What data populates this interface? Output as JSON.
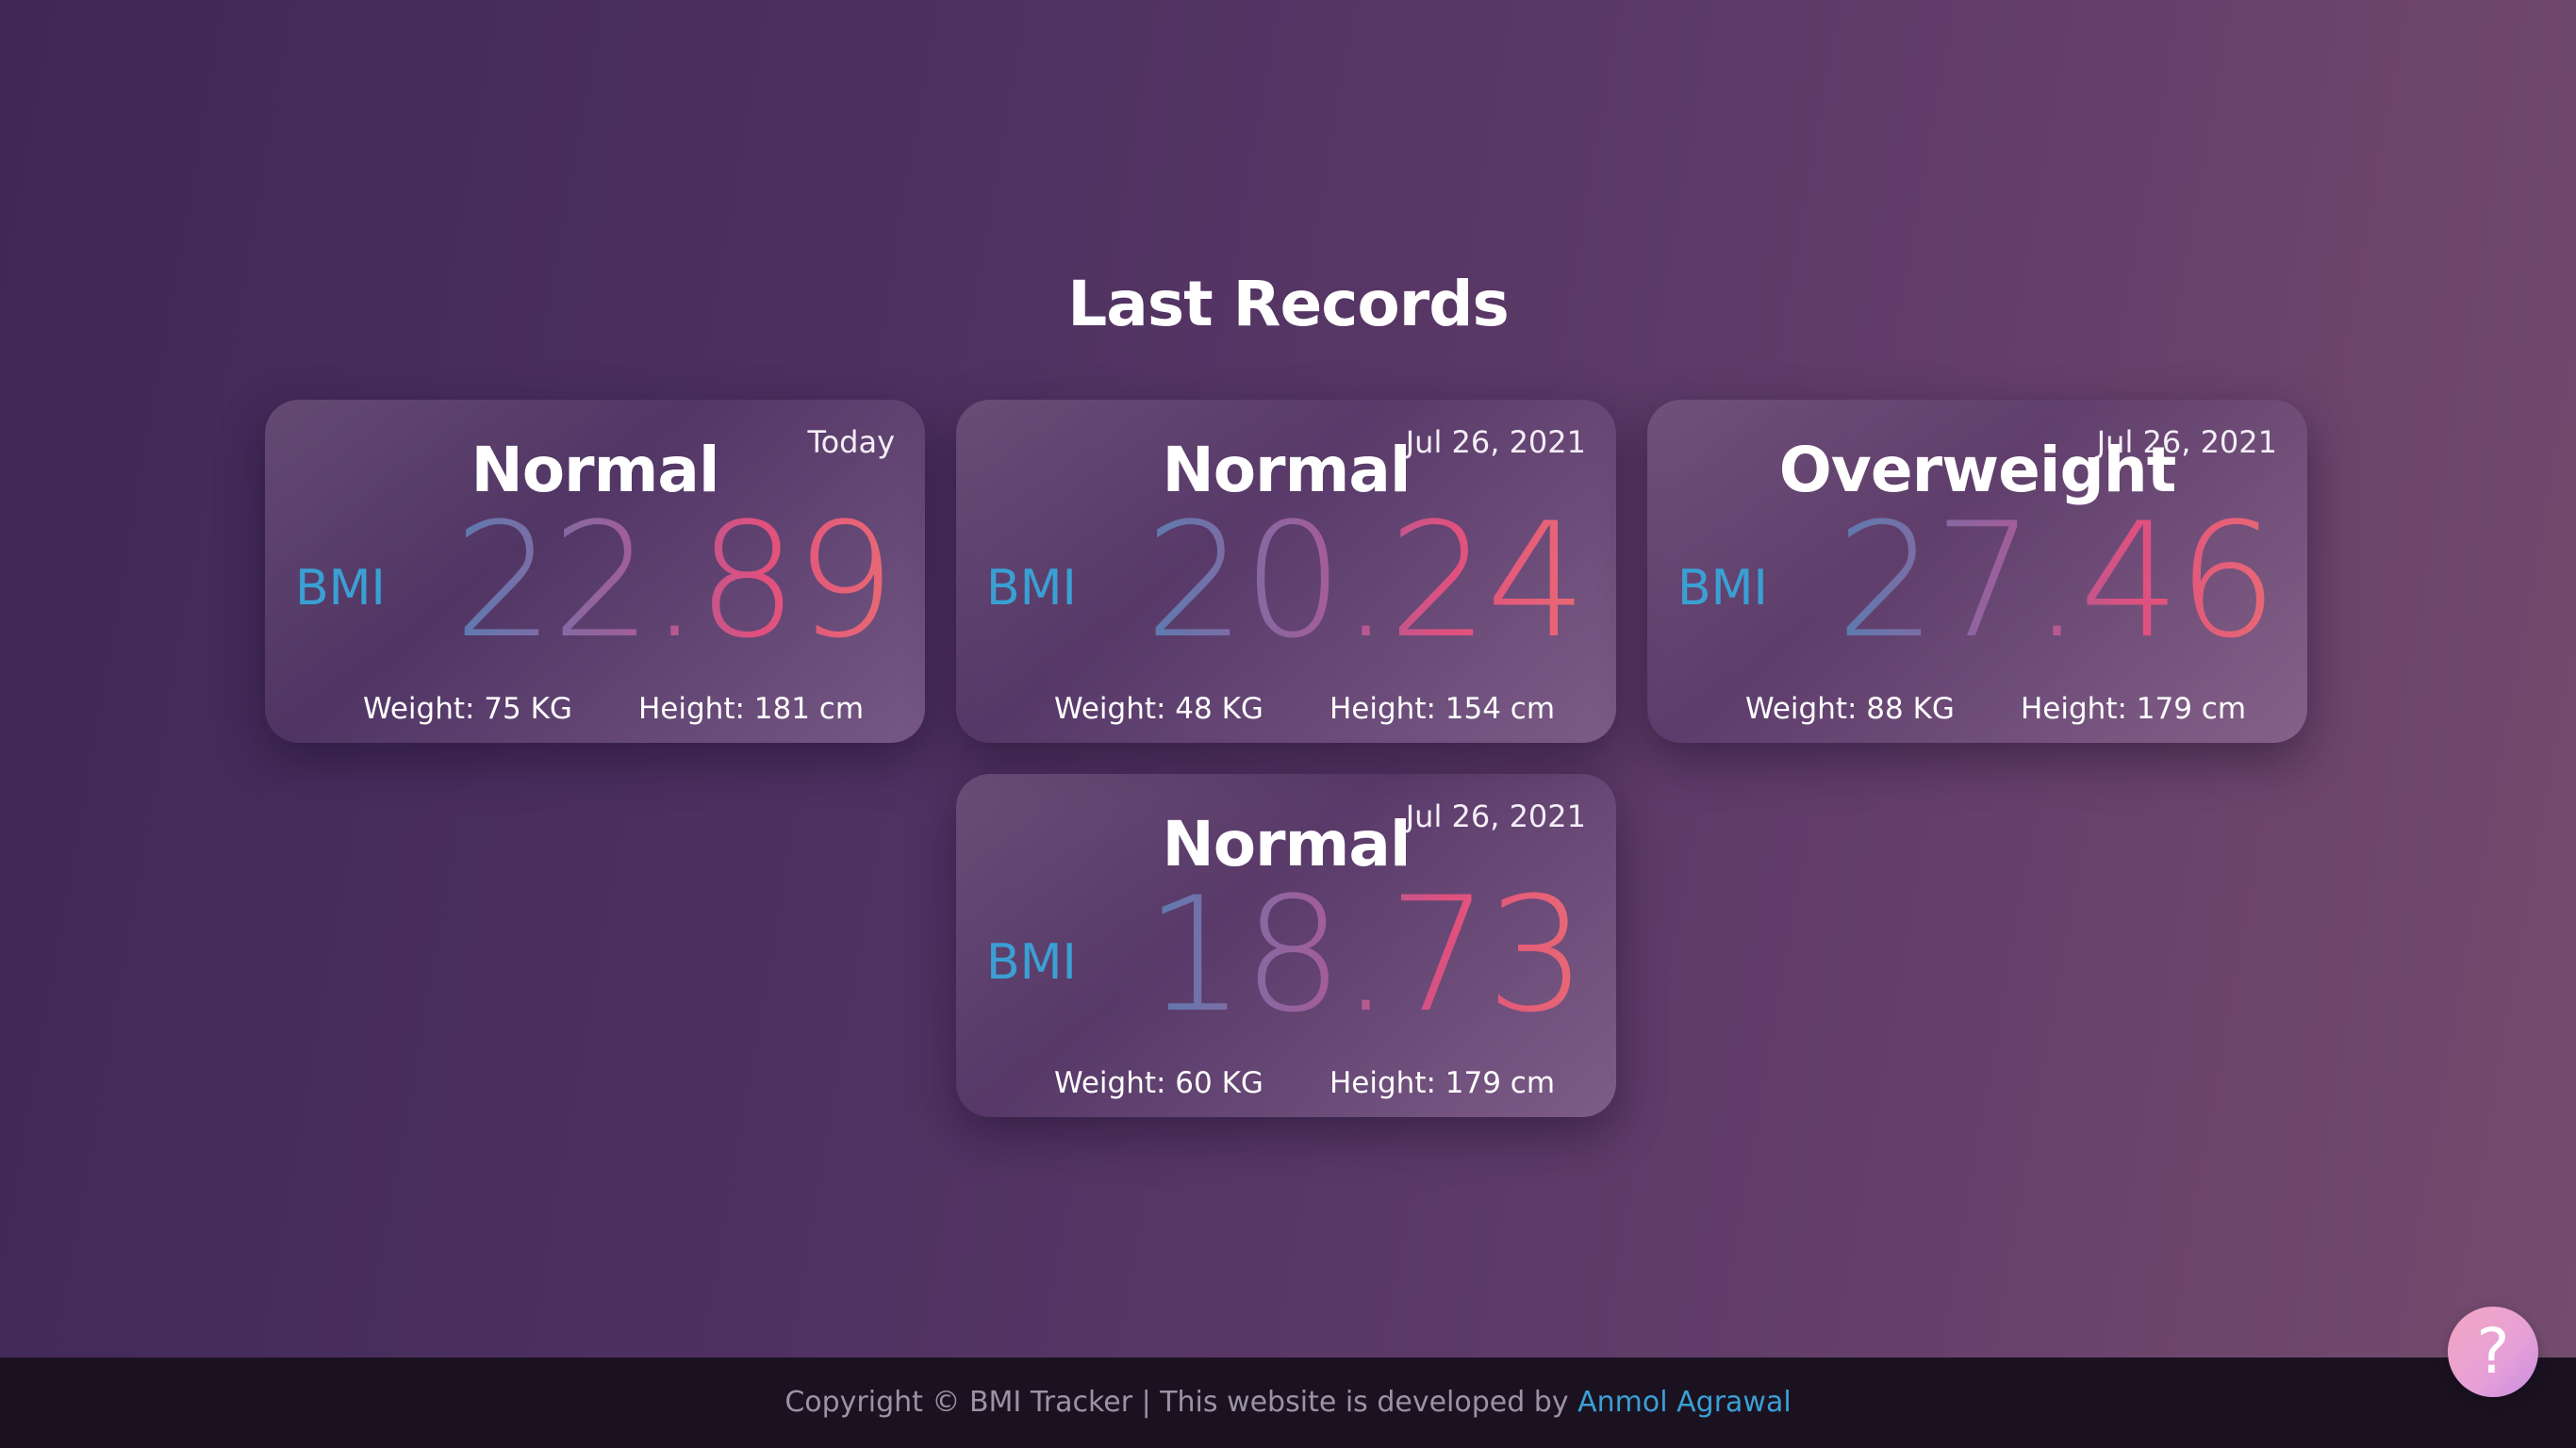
{
  "page": {
    "title": "Last Records"
  },
  "records": [
    {
      "date": "Today",
      "status": "Normal",
      "bmi_label": "BMI",
      "bmi": "22.89",
      "weight": "Weight: 75 KG",
      "height": "Height: 181 cm"
    },
    {
      "date": "Jul 26, 2021",
      "status": "Normal",
      "bmi_label": "BMI",
      "bmi": "20.24",
      "weight": "Weight: 48 KG",
      "height": "Height: 154 cm"
    },
    {
      "date": "Jul 26, 2021",
      "status": "Overweight",
      "bmi_label": "BMI",
      "bmi": "27.46",
      "weight": "Weight: 88 KG",
      "height": "Height: 179 cm"
    },
    {
      "date": "Jul 26, 2021",
      "status": "Normal",
      "bmi_label": "BMI",
      "bmi": "18.73",
      "weight": "Weight: 60 KG",
      "height": "Height: 179 cm"
    }
  ],
  "footer": {
    "text": "Copyright © BMI Tracker | This website is developed by ",
    "author_link": "Anmol Agrawal"
  },
  "help_button": {
    "label": "?",
    "icon": "question-mark-icon"
  },
  "colors": {
    "accent": "#3aa0d4",
    "footer_bg": "#1b1221"
  }
}
